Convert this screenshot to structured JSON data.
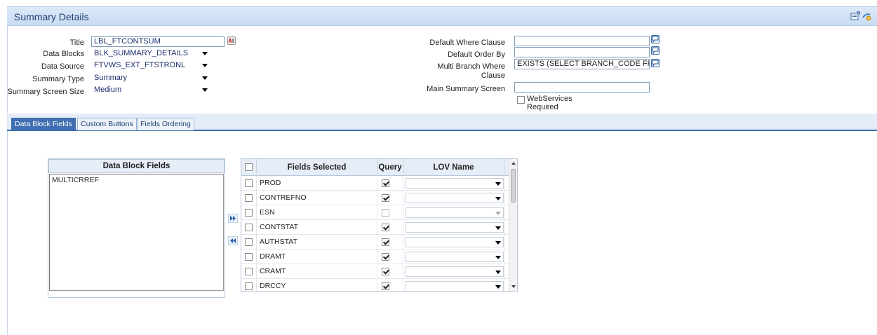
{
  "header": {
    "title": "Summary Details",
    "icons": [
      "export-icon",
      "help-icon"
    ]
  },
  "form_left": {
    "title_label": "Title",
    "title_value": "LBL_FTCONTSUM",
    "data_blocks_label": "Data Blocks",
    "data_blocks_value": "BLK_SUMMARY_DETAILS",
    "data_source_label": "Data Source",
    "data_source_value": "FTVWS_EXT_FTSTRONL",
    "summary_type_label": "Summary Type",
    "summary_type_value": "Summary",
    "screen_size_label": "Summary Screen Size",
    "screen_size_value": "Medium"
  },
  "form_right": {
    "where_label": "Default Where Clause",
    "where_value": "",
    "order_label": "Default Order By",
    "order_value": "",
    "multi_label_1": "Multi Branch Where",
    "multi_label_2": "Clause",
    "multi_value": "EXISTS (SELECT BRANCH_CODE FROM",
    "main_label": "Main Summary Screen",
    "main_value": "",
    "ws_label_1": "WebServices",
    "ws_label_2": "Required"
  },
  "tabs": [
    {
      "label": "Data Block Fields",
      "active": true
    },
    {
      "label": "Custom Buttons",
      "active": false
    },
    {
      "label": "Fields Ordering",
      "active": false
    }
  ],
  "data_block_fields": {
    "header": "Data Block Fields",
    "items": [
      "MULTICRREF"
    ]
  },
  "grid": {
    "headers": {
      "fields": "Fields Selected",
      "query": "Query",
      "lov": "LOV Name"
    },
    "rows": [
      {
        "field": "PROD",
        "query": true
      },
      {
        "field": "CONTREFNO",
        "query": true
      },
      {
        "field": "ESN",
        "query": false
      },
      {
        "field": "CONTSTAT",
        "query": true
      },
      {
        "field": "AUTHSTAT",
        "query": true
      },
      {
        "field": "DRAMT",
        "query": true
      },
      {
        "field": "CRAMT",
        "query": true
      },
      {
        "field": "DRCCY",
        "query": true
      }
    ]
  }
}
